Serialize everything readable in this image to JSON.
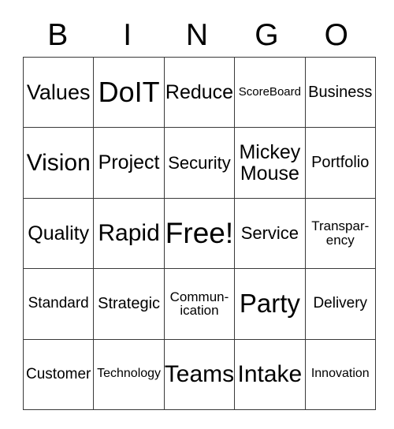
{
  "card": {
    "headers": [
      {
        "letter": "B"
      },
      {
        "letter": "I"
      },
      {
        "letter": "N"
      },
      {
        "letter": "G"
      },
      {
        "letter": "O"
      }
    ],
    "rows": [
      [
        {
          "text": "Values",
          "size": "fs-27"
        },
        {
          "text": "DoIT",
          "size": "fs-36"
        },
        {
          "text": "Reduce",
          "size": "fs-25"
        },
        {
          "text": "ScoreBoard",
          "size": "fs-15"
        },
        {
          "text": "Business",
          "size": "fs-20"
        }
      ],
      [
        {
          "text": "Vision",
          "size": "fs-30"
        },
        {
          "text": "Project",
          "size": "fs-25"
        },
        {
          "text": "Security",
          "size": "fs-22"
        },
        {
          "text": "Mickey\nMouse",
          "size": "fs-25"
        },
        {
          "text": "Portfolio",
          "size": "fs-20"
        }
      ],
      [
        {
          "text": "Quality",
          "size": "fs-25"
        },
        {
          "text": "Rapid",
          "size": "fs-30"
        },
        {
          "text": "Free!",
          "size": "fs-37"
        },
        {
          "text": "Service",
          "size": "fs-22"
        },
        {
          "text": "Transpar-\nency",
          "size": "fs-17"
        }
      ],
      [
        {
          "text": "Standard",
          "size": "fs-19"
        },
        {
          "text": "Strategic",
          "size": "fs-20"
        },
        {
          "text": "Commun-\nication",
          "size": "fs-17"
        },
        {
          "text": "Party",
          "size": "fs-33"
        },
        {
          "text": "Delivery",
          "size": "fs-19"
        }
      ],
      [
        {
          "text": "Customer",
          "size": "fs-19"
        },
        {
          "text": "Technology",
          "size": "fs-16"
        },
        {
          "text": "Teams",
          "size": "fs-30"
        },
        {
          "text": "Intake",
          "size": "fs-30"
        },
        {
          "text": "Innovation",
          "size": "fs-16"
        }
      ]
    ]
  },
  "colors": {
    "grid_line": "#3a3a3a",
    "cell_background": "#ffffff",
    "text": "#000000",
    "page_background": "#ffffff"
  }
}
